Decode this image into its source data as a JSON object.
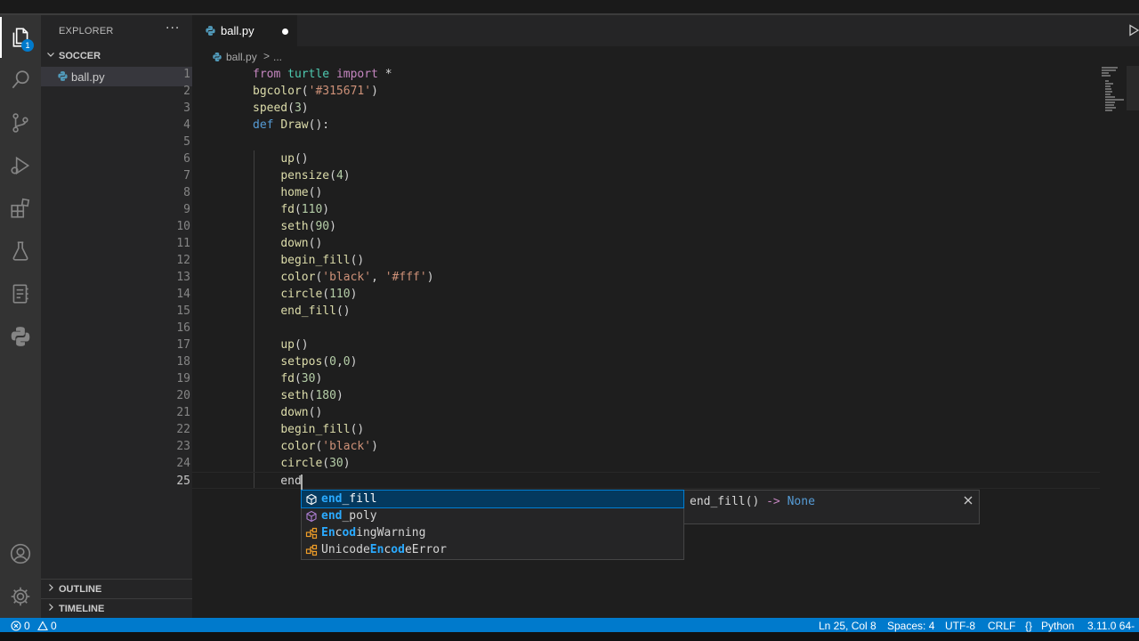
{
  "sidebar": {
    "title": "EXPLORER",
    "more": "···",
    "folder": "SOCCER",
    "file": "ball.py",
    "outline": "OUTLINE",
    "timeline": "TIMELINE"
  },
  "activity": {
    "explorer_badge": "1",
    "icons": [
      "files-icon",
      "search-icon",
      "source-control-icon",
      "run-debug-icon",
      "extensions-icon",
      "testing-icon",
      "notebook-icon",
      "python-icon",
      "account-icon",
      "settings-gear-icon"
    ]
  },
  "tab": {
    "label": "ball.py",
    "modified": true
  },
  "breadcrumb": {
    "file": "ball.py",
    "sep": ">",
    "ellipsis": "..."
  },
  "editor": {
    "current_line": 25,
    "lines": [
      "from turtle import *",
      "bgcolor('#315671')",
      "speed(3)",
      "def Draw():",
      "",
      "    up()",
      "    pensize(4)",
      "    home()",
      "    fd(110)",
      "    seth(90)",
      "    down()",
      "    begin_fill()",
      "    color('black', '#fff')",
      "    circle(110)",
      "    end_fill()",
      "",
      "    up()",
      "    setpos(0,0)",
      "    fd(30)",
      "    seth(180)",
      "    down()",
      "    begin_fill()",
      "    color('black')",
      "    circle(30)",
      "    end"
    ]
  },
  "suggest": {
    "items": [
      {
        "label": "end_fill",
        "kind": "method"
      },
      {
        "label": "end_poly",
        "kind": "method"
      },
      {
        "label": "EncodingWarning",
        "kind": "class"
      },
      {
        "label": "UnicodeEncodeError",
        "kind": "class"
      }
    ],
    "detail": {
      "name": "end_fill()",
      "arrow": "->",
      "ret": "None"
    }
  },
  "status": {
    "errors": "0",
    "warnings": "0",
    "position": "Ln 25, Col 8",
    "spaces": "Spaces: 4",
    "encoding": "UTF-8",
    "eol": "CRLF",
    "language": "Python",
    "interpreter": "3.11.0 64-"
  },
  "colors": {
    "accent": "#007acc",
    "editor_bg": "#1e1e1e",
    "sidebar_bg": "#252526",
    "activity_bg": "#333333",
    "keyword": "#c586c0",
    "function": "#dcdcaa",
    "string": "#ce9178",
    "number": "#b5cea8",
    "module": "#4ec9b0",
    "def": "#569cd6"
  }
}
